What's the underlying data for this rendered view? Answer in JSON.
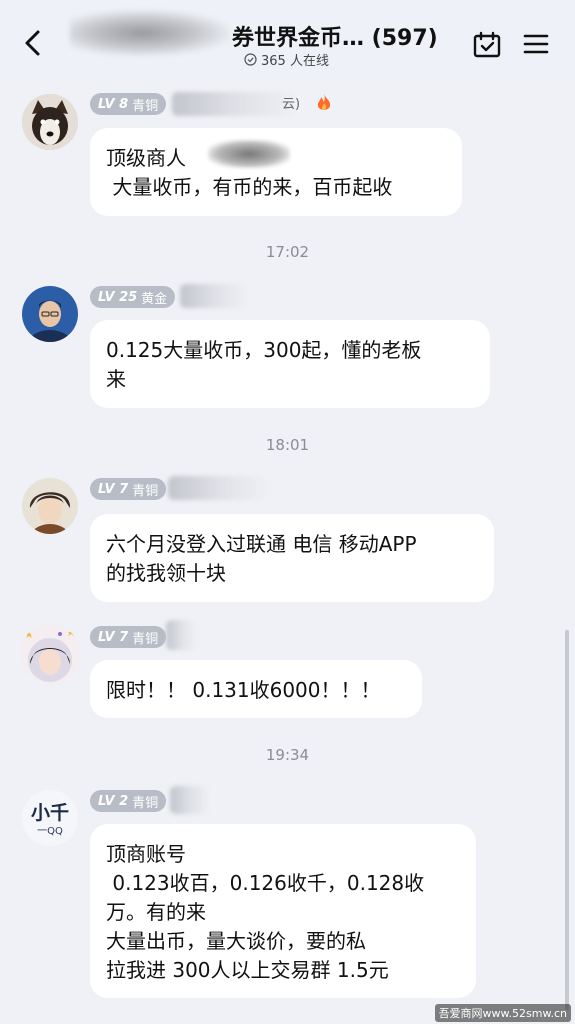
{
  "header": {
    "title": "券世界金币… (597)",
    "online_count": "365 人在线"
  },
  "messages": [
    {
      "level": "LV 8",
      "rank": "青铜",
      "name_suffix": "云)",
      "lines": [
        "顶级商人",
        " 大量收币，有币的来，百币起收"
      ]
    },
    {
      "time": "17:02"
    },
    {
      "level": "LV 25",
      "rank": "黄金",
      "lines": [
        "0.125大量收币，300起，懂的老板",
        "来"
      ]
    },
    {
      "time": "18:01"
    },
    {
      "level": "LV 7",
      "rank": "青铜",
      "lines": [
        "六个月没登入过联通 电信 移动APP",
        "的找我领十块"
      ]
    },
    {
      "level": "LV 7",
      "rank": "青铜",
      "lines": [
        "限时！！ 0.131收6000！！！"
      ]
    },
    {
      "time": "19:34"
    },
    {
      "level": "LV 2",
      "rank": "青铜",
      "avatar_text": [
        "小千",
        "一QQ"
      ],
      "lines": [
        "顶商账号",
        " 0.123收百，0.126收千，0.128收",
        "万。有的来",
        "大量出币，量大谈价，要的私",
        "拉我进 300人以上交易群 1.5元"
      ]
    }
  ],
  "watermark": "吾爱商网www.52smw.cn",
  "colors": {
    "background": "#eff1f6",
    "bubble": "#ffffff",
    "badge": "#b8bcc6",
    "timestamp": "#8a8d96"
  }
}
